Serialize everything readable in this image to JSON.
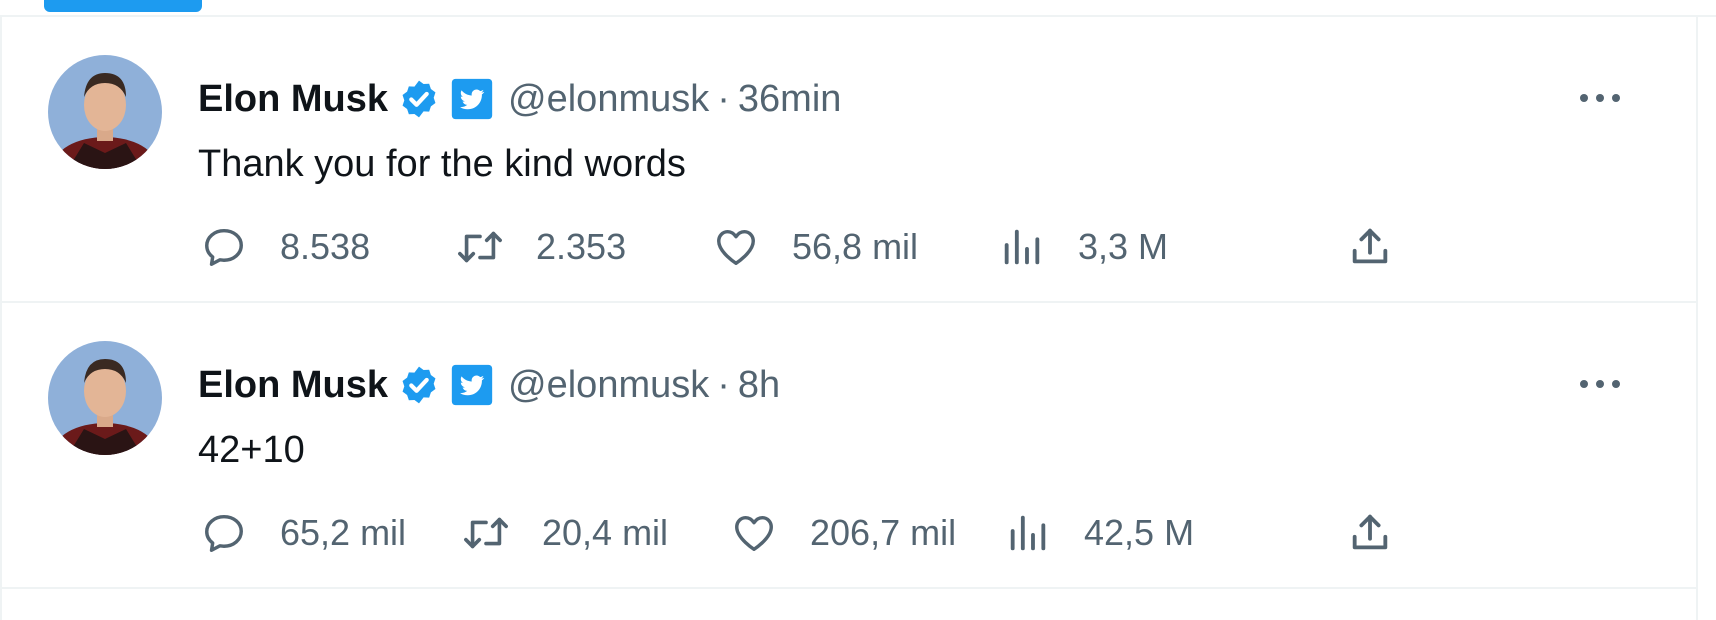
{
  "colors": {
    "accent": "#1d9bf0",
    "text_primary": "#0f1419",
    "text_secondary": "#536471",
    "border": "#eff3f4"
  },
  "tweets": [
    {
      "author": {
        "name": "Elon Musk",
        "handle": "@elonmusk"
      },
      "separator": "·",
      "time": "36min",
      "text": "Thank you for the kind words",
      "stats": {
        "replies": "8.538",
        "retweets": "2.353",
        "likes": "56,8 mil",
        "views": "3,3 M"
      },
      "icons": [
        "reply-icon",
        "retweet-icon",
        "like-icon",
        "views-icon",
        "share-icon"
      ]
    },
    {
      "author": {
        "name": "Elon Musk",
        "handle": "@elonmusk"
      },
      "separator": "·",
      "time": "8h",
      "text": "42+10",
      "stats": {
        "replies": "65,2 mil",
        "retweets": "20,4 mil",
        "likes": "206,7 mil",
        "views": "42,5 M"
      },
      "icons": [
        "reply-icon",
        "retweet-icon",
        "like-icon",
        "views-icon",
        "share-icon"
      ]
    }
  ]
}
